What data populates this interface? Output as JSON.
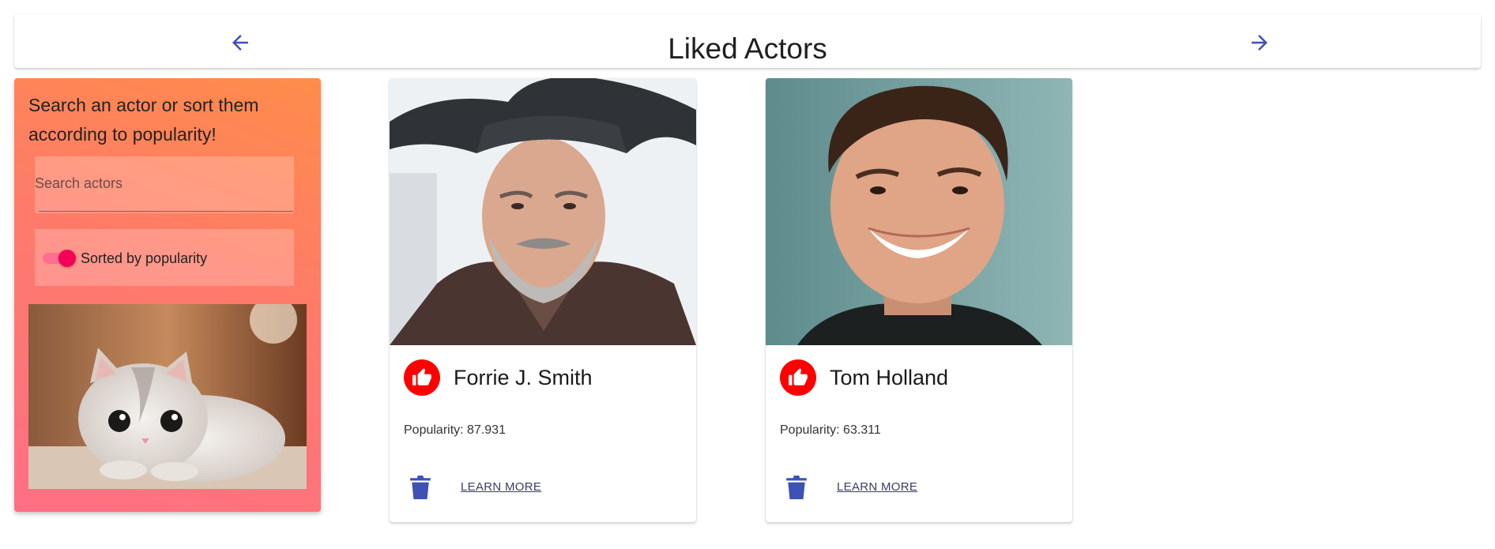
{
  "header": {
    "title": "Liked Actors",
    "prev_icon": "arrow-back-icon",
    "next_icon": "arrow-forward-icon"
  },
  "sidebar": {
    "intro": "Search an actor or sort them according to popularity!",
    "search": {
      "placeholder": "Search actors",
      "value": ""
    },
    "sort_toggle": {
      "label": "Sorted by popularity",
      "on": true
    },
    "image_subject": "kitten photo"
  },
  "actors": [
    {
      "name": "Forrie J. Smith",
      "popularity_label": "Popularity: 87.931",
      "liked": true,
      "learn_more_label": "LEARN MORE"
    },
    {
      "name": "Tom Holland",
      "popularity_label": "Popularity: 63.311",
      "liked": true,
      "learn_more_label": "LEARN MORE"
    }
  ],
  "colors": {
    "primary": "#3f51b5",
    "like": "#ff0000",
    "toggle_thumb": "#f50057",
    "sidebar_gradient_top": "#ff8c4a",
    "sidebar_gradient_bottom": "#ff6f85"
  },
  "icons": {
    "like": "thumb-up-icon",
    "delete": "trash-icon"
  }
}
